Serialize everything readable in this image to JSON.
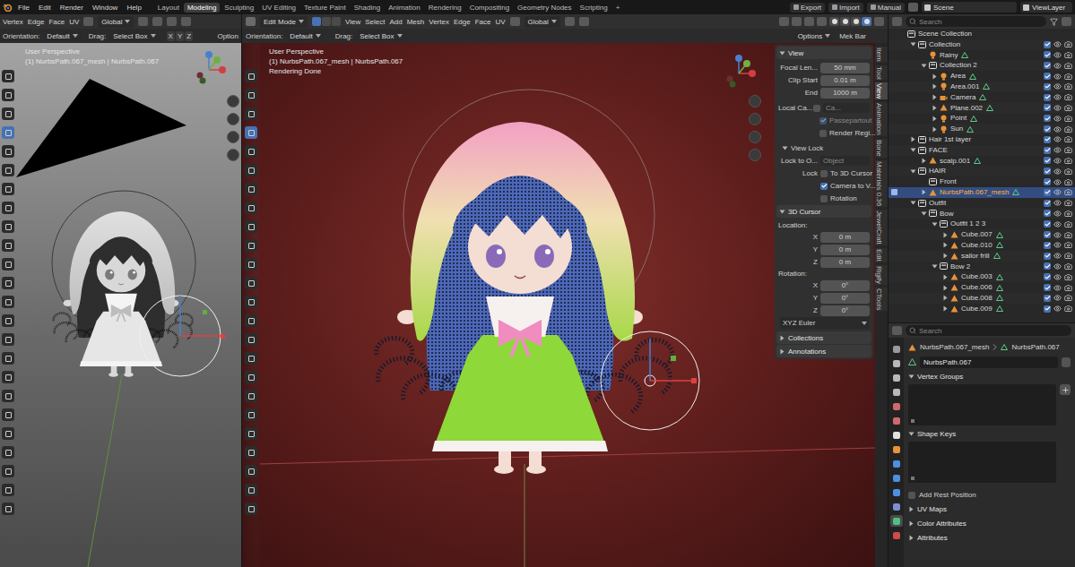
{
  "menubar": {
    "menus": [
      "File",
      "Edit",
      "Render",
      "Window",
      "Help"
    ],
    "workspaces": [
      {
        "label": "Layout",
        "selected": false
      },
      {
        "label": "Modeling",
        "selected": true
      },
      {
        "label": "Sculpting",
        "selected": false
      },
      {
        "label": "UV Editing",
        "selected": false
      },
      {
        "label": "Texture Paint",
        "selected": false
      },
      {
        "label": "Shading",
        "selected": false
      },
      {
        "label": "Animation",
        "selected": false
      },
      {
        "label": "Rendering",
        "selected": false
      },
      {
        "label": "Compositing",
        "selected": false
      },
      {
        "label": "Geometry Nodes",
        "selected": false
      },
      {
        "label": "Scripting",
        "selected": false
      },
      {
        "label": "+",
        "selected": false
      }
    ],
    "buttons": [
      "Export",
      "Import",
      "Manual"
    ],
    "scene": "Scene",
    "view_layer": "ViewLayer"
  },
  "tools": [
    {
      "selected": false
    },
    {
      "selected": false
    },
    {
      "selected": false
    },
    {
      "selected": true
    },
    {
      "selected": false
    },
    {
      "selected": false
    },
    {
      "selected": false
    },
    {
      "selected": false
    },
    {
      "selected": false
    },
    {
      "selected": false
    },
    {
      "selected": false
    },
    {
      "selected": false
    },
    {
      "selected": false
    },
    {
      "selected": false
    },
    {
      "selected": false
    },
    {
      "selected": false
    },
    {
      "selected": false
    },
    {
      "selected": false
    },
    {
      "selected": false
    },
    {
      "selected": false
    },
    {
      "selected": false
    },
    {
      "selected": false
    },
    {
      "selected": false
    },
    {
      "selected": false
    }
  ],
  "left_viewport": {
    "menus": [
      "Vertex",
      "Edge",
      "Face",
      "UV"
    ],
    "transform": "Global",
    "orientation_label": "Orientation:",
    "orientation": "Default",
    "drag_label": "Drag:",
    "drag": "Select Box",
    "axes": [
      "X",
      "Y",
      "Z"
    ],
    "options": "Option",
    "overlay_lines": [
      "User Perspective",
      "(1) NurbsPath.067_mesh | NurbsPath.067"
    ]
  },
  "main_viewport": {
    "mode": "Edit Mode",
    "select_modes": [
      {
        "selected": true
      },
      {
        "selected": false
      },
      {
        "selected": false
      }
    ],
    "menus": [
      "View",
      "Select",
      "Add",
      "Mesh",
      "Vertex",
      "Edge",
      "Face",
      "UV"
    ],
    "transform": "Global",
    "shading_modes": [
      {
        "selected": false
      },
      {
        "selected": false
      },
      {
        "selected": false
      },
      {
        "selected": true
      }
    ],
    "orientation_label": "Orientation:",
    "orientation": "Default",
    "drag_label": "Drag:",
    "drag": "Select Box",
    "options": "Options",
    "addon": "Mek Bar",
    "overlay_lines": [
      "User Perspective",
      "(1) NurbsPath.067_mesh | NurbsPath.067",
      "Rendering Done"
    ]
  },
  "sidebar": {
    "tabs": [
      {
        "label": "Item",
        "selected": false
      },
      {
        "label": "Tool",
        "selected": false
      },
      {
        "label": "View",
        "selected": true
      },
      {
        "label": "Animation",
        "selected": false
      },
      {
        "label": "Bone",
        "selected": false
      },
      {
        "label": "Materials 0.36",
        "selected": false
      },
      {
        "label": "JewelCraft",
        "selected": false
      },
      {
        "label": "Edit",
        "selected": false
      },
      {
        "label": "Rigify",
        "selected": false
      },
      {
        "label": "CTools",
        "selected": false
      }
    ],
    "view": {
      "title": "View",
      "fields": [
        {
          "label": "Focal Len...",
          "value": "50 mm"
        },
        {
          "label": "Clip Start",
          "value": "0.01 m"
        },
        {
          "label": "End",
          "value": "1000 m"
        }
      ],
      "local_camera": {
        "label": "Local Ca...",
        "checked": false,
        "value": "Ca..."
      },
      "checks": [
        {
          "label": "Passepartout",
          "checked": true,
          "disabled": true
        },
        {
          "label": "Render Regi...",
          "checked": false,
          "disabled": false
        }
      ]
    },
    "view_lock": {
      "title": "View Lock",
      "lock_to_label": "Lock to O...",
      "lock_to_placeholder": "Object",
      "lock_label": "Lock",
      "checks": [
        {
          "label": "To 3D Cursor",
          "checked": false
        },
        {
          "label": "Camera to V...",
          "checked": true
        },
        {
          "label": "Rotation",
          "checked": false
        }
      ]
    },
    "cursor": {
      "title": "3D Cursor",
      "location_label": "Location:",
      "location": [
        {
          "axis": "X",
          "value": "0 m"
        },
        {
          "axis": "Y",
          "value": "0 m"
        },
        {
          "axis": "Z",
          "value": "0 m"
        }
      ],
      "rotation_label": "Rotation:",
      "rotation": [
        {
          "axis": "X",
          "value": "0°"
        },
        {
          "axis": "Y",
          "value": "0°"
        },
        {
          "axis": "Z",
          "value": "0°"
        }
      ],
      "rotation_mode": "XYZ Euler"
    },
    "collapsed_panels": [
      "Collections",
      "Annotations"
    ]
  },
  "outliner": {
    "search_placeholder": "Search",
    "items": [
      {
        "label": "Scene Collection",
        "kind": "scene",
        "collapsible": false,
        "expanded": true,
        "selected": false,
        "children": [
          {
            "label": "Collection",
            "kind": "collection",
            "collapsible": true,
            "expanded": true,
            "selected": false,
            "checked": true,
            "children": [
              {
                "label": "Rainy",
                "kind": "light",
                "collapsible": false,
                "expanded": false,
                "selected": false,
                "checked": true,
                "children": []
              },
              {
                "label": "Collection 2",
                "kind": "collection",
                "collapsible": true,
                "expanded": true,
                "selected": false,
                "checked": true,
                "children": [
                  {
                    "label": "Area",
                    "kind": "light",
                    "collapsible": true,
                    "expanded": false,
                    "selected": false,
                    "checked": true,
                    "children": []
                  },
                  {
                    "label": "Area.001",
                    "kind": "light",
                    "collapsible": true,
                    "expanded": false,
                    "selected": false,
                    "checked": true,
                    "children": []
                  },
                  {
                    "label": "Camera",
                    "kind": "camera",
                    "collapsible": true,
                    "expanded": false,
                    "selected": false,
                    "checked": true,
                    "children": []
                  },
                  {
                    "label": "Plane.002",
                    "kind": "mesh",
                    "collapsible": true,
                    "expanded": false,
                    "selected": false,
                    "checked": true,
                    "children": []
                  },
                  {
                    "label": "Point",
                    "kind": "light",
                    "collapsible": true,
                    "expanded": false,
                    "selected": false,
                    "checked": true,
                    "children": []
                  },
                  {
                    "label": "Sun",
                    "kind": "light",
                    "collapsible": true,
                    "expanded": false,
                    "selected": false,
                    "checked": true,
                    "children": []
                  }
                ]
              }
            ]
          },
          {
            "label": "Hair 1st layer",
            "kind": "collection",
            "collapsible": true,
            "expanded": false,
            "selected": false,
            "checked": true,
            "children": []
          },
          {
            "label": "FACE",
            "kind": "collection",
            "collapsible": true,
            "expanded": true,
            "selected": false,
            "checked": true,
            "children": [
              {
                "label": "scalp.001",
                "kind": "mesh",
                "collapsible": true,
                "expanded": false,
                "selected": false,
                "checked": true,
                "children": []
              }
            ]
          },
          {
            "label": "HAIR",
            "kind": "collection",
            "collapsible": true,
            "expanded": true,
            "selected": false,
            "checked": true,
            "children": [
              {
                "label": "Front",
                "kind": "collection",
                "collapsible": false,
                "expanded": false,
                "selected": false,
                "checked": true,
                "children": []
              },
              {
                "label": "NurbsPath.067_mesh",
                "kind": "mesh",
                "collapsible": true,
                "expanded": false,
                "selected": true,
                "checked": true,
                "children": []
              }
            ]
          },
          {
            "label": "Outfit",
            "kind": "collection",
            "collapsible": true,
            "expanded": true,
            "selected": false,
            "checked": true,
            "children": [
              {
                "label": "Bow",
                "kind": "collection",
                "collapsible": true,
                "expanded": true,
                "selected": false,
                "checked": true,
                "children": [
                  {
                    "label": "Outfit 1 2 3",
                    "kind": "collection",
                    "collapsible": true,
                    "expanded": true,
                    "selected": false,
                    "checked": true,
                    "children": [
                      {
                        "label": "Cube.007",
                        "kind": "mesh",
                        "collapsible": true,
                        "expanded": false,
                        "selected": false,
                        "checked": true,
                        "children": []
                      },
                      {
                        "label": "Cube.010",
                        "kind": "mesh",
                        "collapsible": true,
                        "expanded": false,
                        "selected": false,
                        "checked": true,
                        "children": []
                      },
                      {
                        "label": "sailor frill",
                        "kind": "mesh",
                        "collapsible": true,
                        "expanded": false,
                        "selected": false,
                        "checked": true,
                        "children": []
                      }
                    ]
                  },
                  {
                    "label": "Bow 2",
                    "kind": "collection",
                    "collapsible": true,
                    "expanded": true,
                    "selected": false,
                    "checked": true,
                    "children": [
                      {
                        "label": "Cube.003",
                        "kind": "mesh",
                        "collapsible": true,
                        "expanded": false,
                        "selected": false,
                        "checked": true,
                        "children": []
                      },
                      {
                        "label": "Cube.006",
                        "kind": "mesh",
                        "collapsible": true,
                        "expanded": false,
                        "selected": false,
                        "checked": true,
                        "children": []
                      },
                      {
                        "label": "Cube.008",
                        "kind": "mesh",
                        "collapsible": true,
                        "expanded": false,
                        "selected": false,
                        "checked": true,
                        "children": []
                      },
                      {
                        "label": "Cube.009",
                        "kind": "mesh",
                        "collapsible": true,
                        "expanded": false,
                        "selected": false,
                        "checked": true,
                        "children": []
                      }
                    ]
                  }
                ]
              }
            ]
          }
        ]
      }
    ]
  },
  "properties": {
    "search_placeholder": "Search",
    "tabs": [
      {
        "selected": false,
        "color": "#9a9a9a"
      },
      {
        "selected": false,
        "color": "#b8b8b8"
      },
      {
        "selected": false,
        "color": "#b8b8b8"
      },
      {
        "selected": false,
        "color": "#b8b8b8"
      },
      {
        "selected": false,
        "color": "#d06a6a"
      },
      {
        "selected": false,
        "color": "#d06a6a"
      },
      {
        "selected": false,
        "color": "#e0e0e0"
      },
      {
        "selected": false,
        "color": "#e8923a"
      },
      {
        "selected": false,
        "color": "#4f8fe0"
      },
      {
        "selected": false,
        "color": "#4f8fe0"
      },
      {
        "selected": false,
        "color": "#4f8fe0"
      },
      {
        "selected": false,
        "color": "#7d8fd0"
      },
      {
        "selected": true,
        "color": "#4fbf7f"
      },
      {
        "selected": false,
        "color": "#d04a4a"
      }
    ],
    "breadcrumb": [
      "NurbsPath.067_mesh",
      "NurbsPath.067"
    ],
    "name": "NurbsPath.067",
    "panels": [
      {
        "kind": "list",
        "title": "Vertex Groups",
        "expanded": true,
        "add_button": true
      },
      {
        "kind": "list",
        "title": "Shape Keys",
        "expanded": true,
        "add_button": false
      },
      {
        "kind": "check",
        "title": "Add Rest Position",
        "checked": false,
        "expanded": false,
        "add_button": false
      },
      {
        "kind": "header",
        "title": "UV Maps",
        "expanded": false,
        "add_button": false
      },
      {
        "kind": "header",
        "title": "Color Attributes",
        "expanded": false,
        "add_button": false
      },
      {
        "kind": "header",
        "title": "Attributes",
        "expanded": false,
        "add_button": false
      }
    ]
  }
}
